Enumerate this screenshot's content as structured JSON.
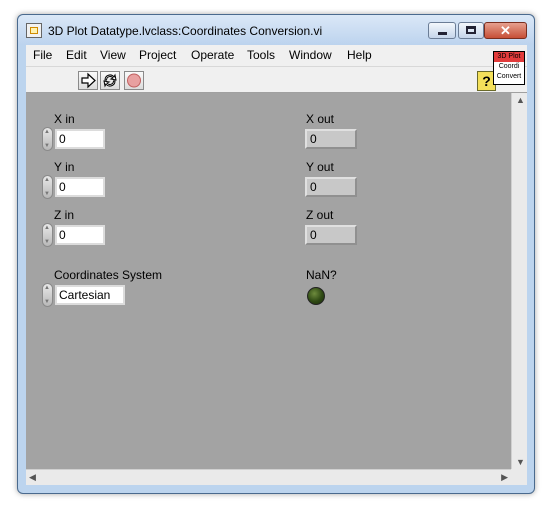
{
  "window": {
    "title": "3D Plot Datatype.lvclass:Coordinates Conversion.vi",
    "buttons": {
      "minimize": "",
      "maximize": "",
      "close": "✕"
    }
  },
  "menu": [
    "File",
    "Edit",
    "View",
    "Project",
    "Operate",
    "Tools",
    "Window",
    "Help"
  ],
  "toolbar": {
    "run_icon": "run-arrow-icon",
    "run_continuous_icon": "run-continuously-icon",
    "abort_icon": "abort-execution-icon",
    "help_label": "?"
  },
  "vi_icon": {
    "line1": "3D Plot",
    "line2": "Coordi",
    "line3": "Convert"
  },
  "controls": {
    "x_in": {
      "label": "X in",
      "value": "0"
    },
    "y_in": {
      "label": "Y in",
      "value": "0"
    },
    "z_in": {
      "label": "Z in",
      "value": "0"
    },
    "coord_system": {
      "label": "Coordinates System",
      "value": "Cartesian"
    }
  },
  "indicators": {
    "x_out": {
      "label": "X out",
      "value": "0"
    },
    "y_out": {
      "label": "Y out",
      "value": "0"
    },
    "z_out": {
      "label": "Z out",
      "value": "0"
    },
    "nan": {
      "label": "NaN?",
      "state": false
    }
  },
  "colors": {
    "panel": "#a3a3a3",
    "led_off": "#2f4a14",
    "help": "#f4e05a"
  }
}
